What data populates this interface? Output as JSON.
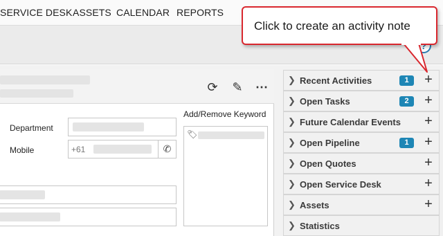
{
  "nav": {
    "items": [
      "SERVICE DESK",
      "ASSETS",
      "CALENDAR",
      "REPORTS"
    ]
  },
  "callout": {
    "text": "Click to create an activity note",
    "border_color": "#d9272e"
  },
  "contact": {
    "header_icons": [
      "refresh-icon",
      "edit-icon",
      "more-icon"
    ],
    "department_label": "Department",
    "mobile_label": "Mobile",
    "mobile_prefix": "+61",
    "keywords_label": "Add/Remove Keyword"
  },
  "sidebar": {
    "accent_color": "#1e86b5",
    "items": [
      {
        "label": "Recent Activities",
        "badge": "1",
        "plus": "+"
      },
      {
        "label": "Open Tasks",
        "badge": "2",
        "plus": "+"
      },
      {
        "label": "Future Calendar Events",
        "badge": null,
        "plus": "+"
      },
      {
        "label": "Open Pipeline",
        "badge": "1",
        "plus": "+"
      },
      {
        "label": "Open Quotes",
        "badge": null,
        "plus": "+"
      },
      {
        "label": "Open Service Desk",
        "badge": null,
        "plus": "+"
      },
      {
        "label": "Assets",
        "badge": null,
        "plus": "+"
      },
      {
        "label": "Statistics",
        "badge": null,
        "plus": null
      }
    ]
  },
  "help": {
    "icon": "help-icon",
    "symbol": "?"
  }
}
